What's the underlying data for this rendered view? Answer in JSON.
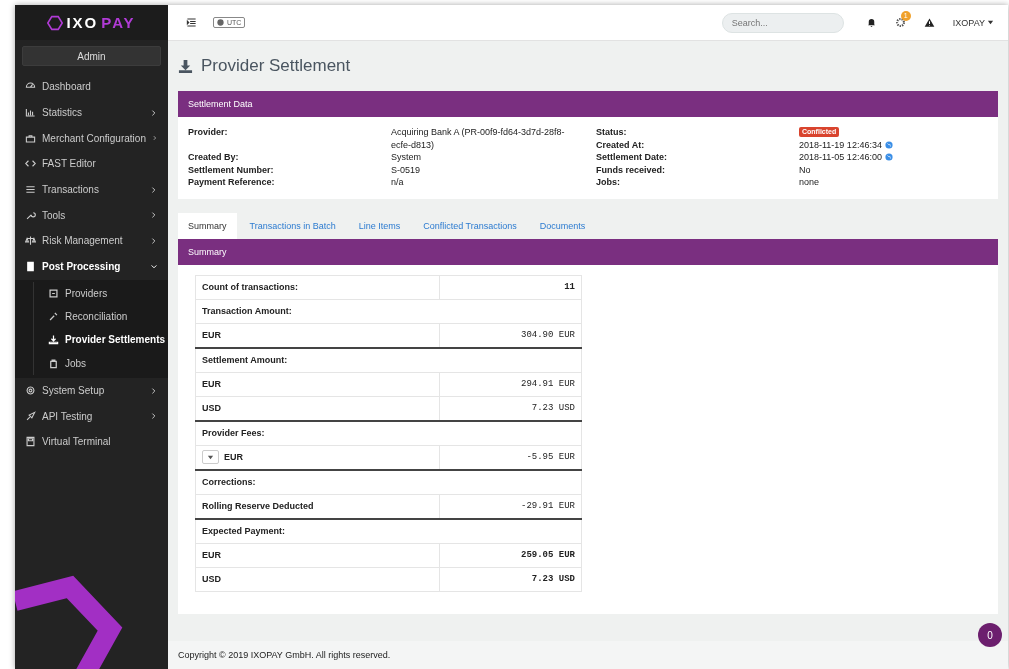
{
  "logo": {
    "parts": [
      "IXO",
      "PAY"
    ]
  },
  "sidebar": {
    "role_button": "Admin",
    "items": [
      {
        "label": "Dashboard",
        "kind": "link",
        "selected": false
      },
      {
        "label": "Statistics",
        "kind": "group",
        "expanded": false,
        "selected": false
      },
      {
        "label": "Merchant Configuration",
        "kind": "group",
        "expanded": false,
        "selected": false
      },
      {
        "label": "FAST Editor",
        "kind": "link",
        "selected": false
      },
      {
        "label": "Transactions",
        "kind": "group",
        "expanded": false,
        "selected": false
      },
      {
        "label": "Tools",
        "kind": "group",
        "expanded": false,
        "selected": false
      },
      {
        "label": "Risk Management",
        "kind": "group",
        "expanded": false,
        "selected": false
      },
      {
        "label": "Post Processing",
        "kind": "group",
        "expanded": true,
        "selected": true,
        "children": [
          {
            "label": "Providers",
            "selected": false
          },
          {
            "label": "Reconciliation",
            "selected": false
          },
          {
            "label": "Provider Settlements",
            "selected": true
          },
          {
            "label": "Jobs",
            "selected": false
          }
        ]
      },
      {
        "label": "System Setup",
        "kind": "group",
        "expanded": false,
        "selected": false
      },
      {
        "label": "API Testing",
        "kind": "group",
        "expanded": false,
        "selected": false
      },
      {
        "label": "Virtual Terminal",
        "kind": "link",
        "selected": false
      }
    ]
  },
  "topbar": {
    "timezone": "UTC",
    "search": {
      "placeholder": "Search..."
    },
    "notification_badge": "1",
    "user": "IXOPAY"
  },
  "page_title": "Provider Settlement",
  "settlement_data": {
    "title": "Settlement Data",
    "left": [
      {
        "label": "Provider:",
        "value": "Acquiring Bank A (PR-00f9-fd64-3d7d-28f8-ecfe-d813)",
        "kind": "text"
      },
      {
        "label": "Created By:",
        "value": "System",
        "kind": "text"
      },
      {
        "label": "Settlement Number:",
        "value": "S-0519",
        "kind": "text"
      },
      {
        "label": "Payment Reference:",
        "value": "n/a",
        "kind": "text"
      }
    ],
    "right": [
      {
        "label": "Status:",
        "value": "Conflicted",
        "kind": "badge"
      },
      {
        "label": "Created At:",
        "value": "2018-11-19 12:46:34",
        "kind": "date"
      },
      {
        "label": "Settlement Date:",
        "value": "2018-11-05 12:46:00",
        "kind": "date"
      },
      {
        "label": "Funds received:",
        "value": "No",
        "kind": "text"
      },
      {
        "label": "Jobs:",
        "value": "none",
        "kind": "text"
      }
    ]
  },
  "tabs": [
    {
      "label": "Summary",
      "selected": true
    },
    {
      "label": "Transactions in Batch",
      "selected": false
    },
    {
      "label": "Line Items",
      "selected": false
    },
    {
      "label": "Conflicted Transactions",
      "selected": false
    },
    {
      "label": "Documents",
      "selected": false
    }
  ],
  "summary": {
    "title": "Summary",
    "count": {
      "label": "Count of transactions:",
      "value": "11"
    },
    "groups": [
      {
        "heading": "Transaction Amount:",
        "rows": [
          {
            "label": "EUR",
            "value": "304.90 EUR",
            "bold": false,
            "toggle": false
          }
        ]
      },
      {
        "heading": "Settlement Amount:",
        "rows": [
          {
            "label": "EUR",
            "value": "294.91 EUR",
            "bold": false,
            "toggle": false
          },
          {
            "label": "USD",
            "value": "7.23 USD",
            "bold": false,
            "toggle": false
          }
        ]
      },
      {
        "heading": "Provider Fees:",
        "rows": [
          {
            "label": "EUR",
            "value": "-5.95 EUR",
            "bold": false,
            "toggle": true
          }
        ]
      },
      {
        "heading": "Corrections:",
        "rows": [
          {
            "label": "Rolling Reserve Deducted",
            "value": "-29.91 EUR",
            "bold": false,
            "toggle": false
          }
        ]
      },
      {
        "heading": "Expected Payment:",
        "rows": [
          {
            "label": "EUR",
            "value": "259.05 EUR",
            "bold": true,
            "toggle": false
          },
          {
            "label": "USD",
            "value": "7.23 USD",
            "bold": true,
            "toggle": false
          }
        ]
      }
    ]
  },
  "footer": "Copyright © 2019 IXOPAY GmbH. All rights reserved.",
  "chat_badge": "0"
}
